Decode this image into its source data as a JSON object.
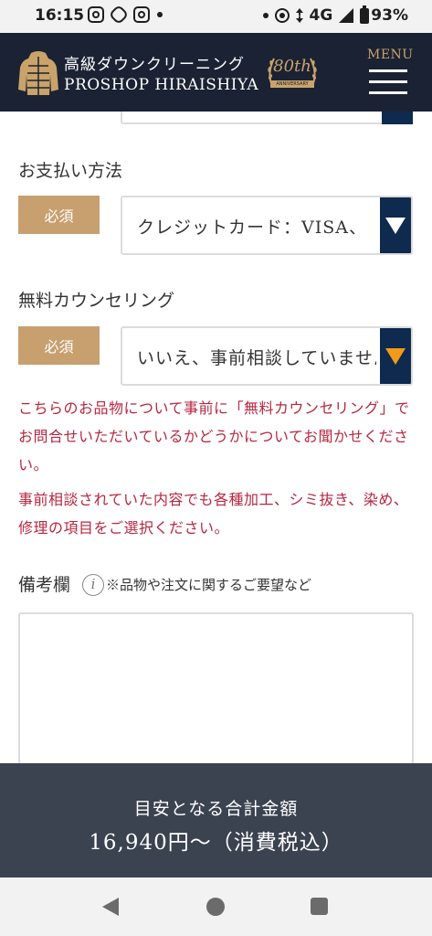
{
  "status_bar": {
    "time": "16:15",
    "network": "4G",
    "battery": "93%",
    "left_icons": [
      "instagram-icon",
      "sync-icon",
      "instagram-icon",
      "dot-icon"
    ],
    "right_icons": [
      "dot-icon",
      "hotspot-icon",
      "data-arrows-icon",
      "signal-icon",
      "battery-icon"
    ]
  },
  "header": {
    "brand_jp": "高級ダウンクリーニング",
    "brand_en": "PROSHOP HIRAISHIYA",
    "badge_number": "80th",
    "badge_text": "ANNIVERSARY",
    "menu_label": "MENU",
    "colors": {
      "background": "#1a2233",
      "gold": "#c9a36a"
    }
  },
  "form": {
    "payment": {
      "label": "お支払い方法",
      "required_badge": "必須",
      "selected_value": "クレジットカード：VISA、"
    },
    "counseling": {
      "label": "無料カウンセリング",
      "required_badge": "必須",
      "selected_value": "いいえ、事前相談していません"
    },
    "note_line1": "こちらのお品物について事前に「無料カウンセリング」でお問合せいただいているかどうかについてお聞かせください。",
    "note_line2": "事前相談されていた内容でも各種加工、シミ抜き、染め、修理の項目をご選択ください。",
    "remarks": {
      "label": "備考欄",
      "info_glyph": "i",
      "hint": "※品物や注文に関するご要望など",
      "value": ""
    },
    "colors": {
      "required_badge": "#c8a06f",
      "select_arrow_bg": "#0e2a4e",
      "note_text": "#b82741",
      "active_arrow": "#f29a1a"
    }
  },
  "total": {
    "label": "目安となる合計金額",
    "value": "16,940円～（消費税込）",
    "background": "#3b4250"
  },
  "nav_bar": {
    "buttons": [
      "back-icon",
      "home-icon",
      "recents-icon"
    ]
  }
}
